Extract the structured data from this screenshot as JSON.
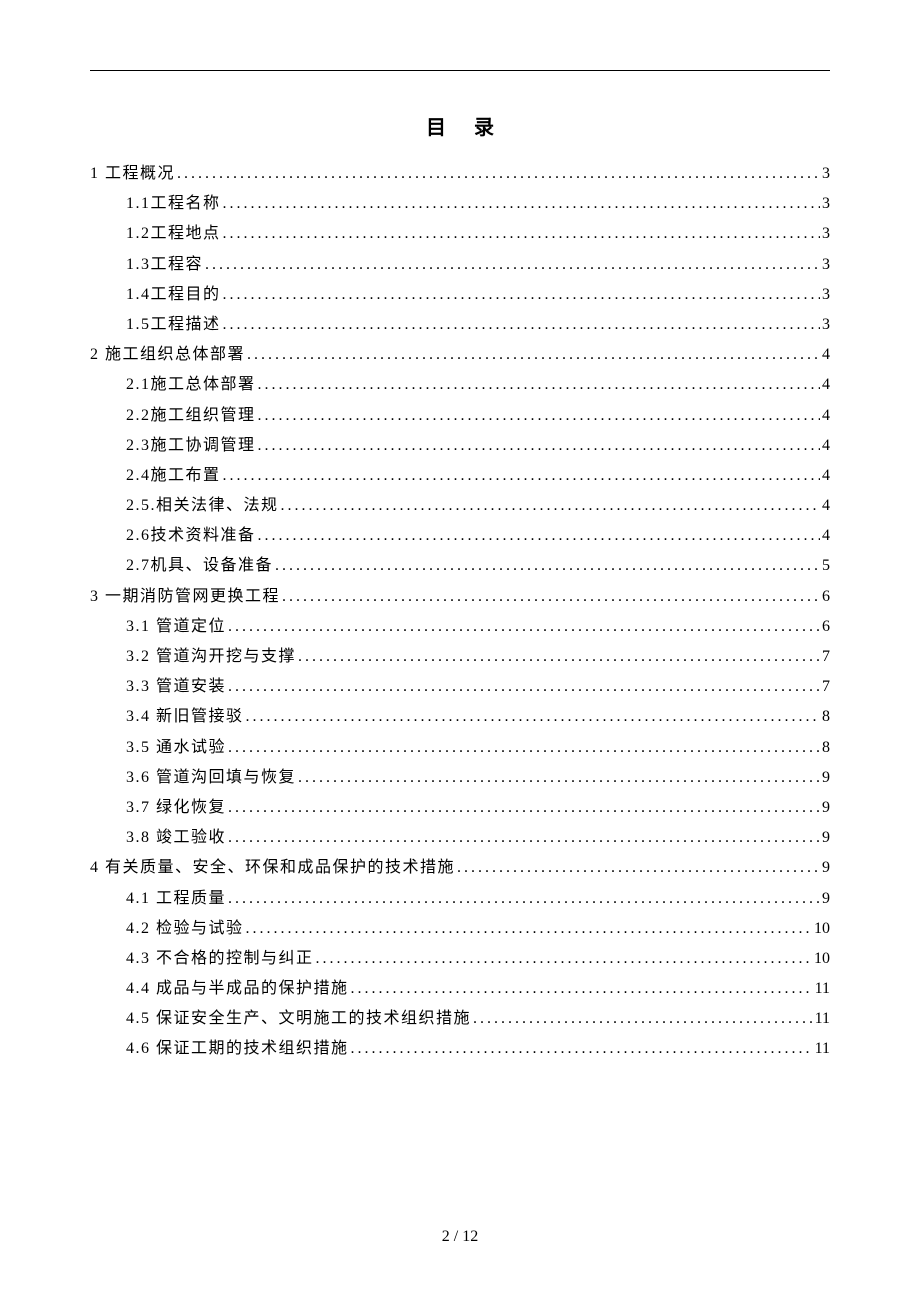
{
  "title": "目录",
  "footer": "2 / 12",
  "toc": [
    {
      "level": 1,
      "label": "1 工程概况",
      "page": "3"
    },
    {
      "level": 2,
      "label": "1.1工程名称",
      "page": "3"
    },
    {
      "level": 2,
      "label": "1.2工程地点",
      "page": "3"
    },
    {
      "level": 2,
      "label": "1.3工程容",
      "page": "3"
    },
    {
      "level": 2,
      "label": "1.4工程目的",
      "page": "3"
    },
    {
      "level": 2,
      "label": "1.5工程描述",
      "page": "3"
    },
    {
      "level": 1,
      "label": "2 施工组织总体部署",
      "page": "4"
    },
    {
      "level": 2,
      "label": "2.1施工总体部署",
      "page": "4"
    },
    {
      "level": 2,
      "label": "2.2施工组织管理",
      "page": "4"
    },
    {
      "level": 2,
      "label": "2.3施工协调管理",
      "page": "4"
    },
    {
      "level": 2,
      "label": "2.4施工布置",
      "page": "4"
    },
    {
      "level": 2,
      "label": "2.5.相关法律、法规",
      "page": "4"
    },
    {
      "level": 2,
      "label": "2.6技术资料准备",
      "page": "4"
    },
    {
      "level": 2,
      "label": "2.7机具、设备准备",
      "page": "5"
    },
    {
      "level": 1,
      "label": "3 一期消防管网更换工程",
      "page": "6"
    },
    {
      "level": 2,
      "label": "3.1 管道定位",
      "page": "6"
    },
    {
      "level": 2,
      "label": "3.2 管道沟开挖与支撑",
      "page": "7"
    },
    {
      "level": 2,
      "label": "3.3 管道安装",
      "page": "7"
    },
    {
      "level": 2,
      "label": "3.4 新旧管接驳",
      "page": "8"
    },
    {
      "level": 2,
      "label": "3.5 通水试验",
      "page": "8"
    },
    {
      "level": 2,
      "label": "3.6 管道沟回填与恢复",
      "page": "9"
    },
    {
      "level": 2,
      "label": "3.7 绿化恢复",
      "page": "9"
    },
    {
      "level": 2,
      "label": "3.8 竣工验收",
      "page": "9"
    },
    {
      "level": 1,
      "label": "4 有关质量、安全、环保和成品保护的技术措施",
      "page": "9"
    },
    {
      "level": 2,
      "label": "4.1 工程质量",
      "page": "9"
    },
    {
      "level": 2,
      "label": "4.2 检验与试验",
      "page": "10"
    },
    {
      "level": 2,
      "label": "4.3 不合格的控制与纠正",
      "page": "10"
    },
    {
      "level": 2,
      "label": "4.4 成品与半成品的保护措施",
      "page": "11"
    },
    {
      "level": 2,
      "label": "4.5 保证安全生产、文明施工的技术组织措施",
      "page": "11"
    },
    {
      "level": 2,
      "label": "4.6 保证工期的技术组织措施",
      "page": "11"
    }
  ]
}
